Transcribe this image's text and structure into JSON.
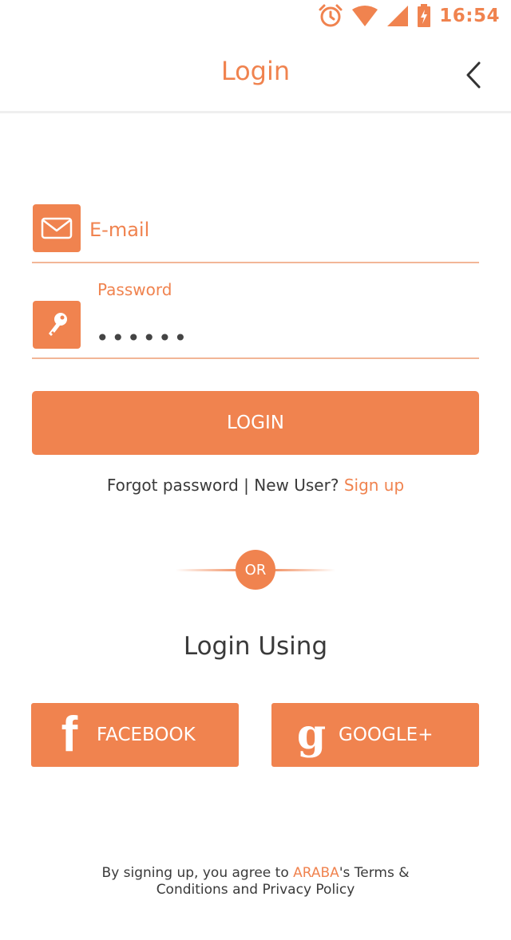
{
  "status_bar": {
    "time": "16:54",
    "icons": [
      "alarm-icon",
      "wifi-icon",
      "signal-icon",
      "battery-charging-icon"
    ],
    "accent": "#f0834f"
  },
  "header": {
    "title": "Login",
    "back_icon": "chevron-left-icon"
  },
  "form": {
    "email": {
      "placeholder": "E-mail",
      "value": "",
      "icon": "envelope-icon"
    },
    "password": {
      "label": "Password",
      "value": "••••••",
      "icon": "key-icon"
    },
    "login_button": "LOGIN"
  },
  "links": {
    "forgot": "Forgot password",
    "separator": " | ",
    "new_user": "New User? ",
    "signup": "Sign up"
  },
  "divider": {
    "or_label": "OR"
  },
  "social": {
    "heading": "Login Using",
    "facebook": {
      "glyph": "f",
      "label": "FACEBOOK"
    },
    "google": {
      "glyph": "g",
      "label": "GOOGLE+"
    }
  },
  "terms": {
    "prefix": "By signing up, you agree to ",
    "brand": "ARABA",
    "suffix_line1": "'s Terms &",
    "line2": "Conditions and Privacy Policy"
  },
  "colors": {
    "accent": "#f0834f",
    "underline": "#f2b697",
    "text": "#3a3a3a"
  }
}
